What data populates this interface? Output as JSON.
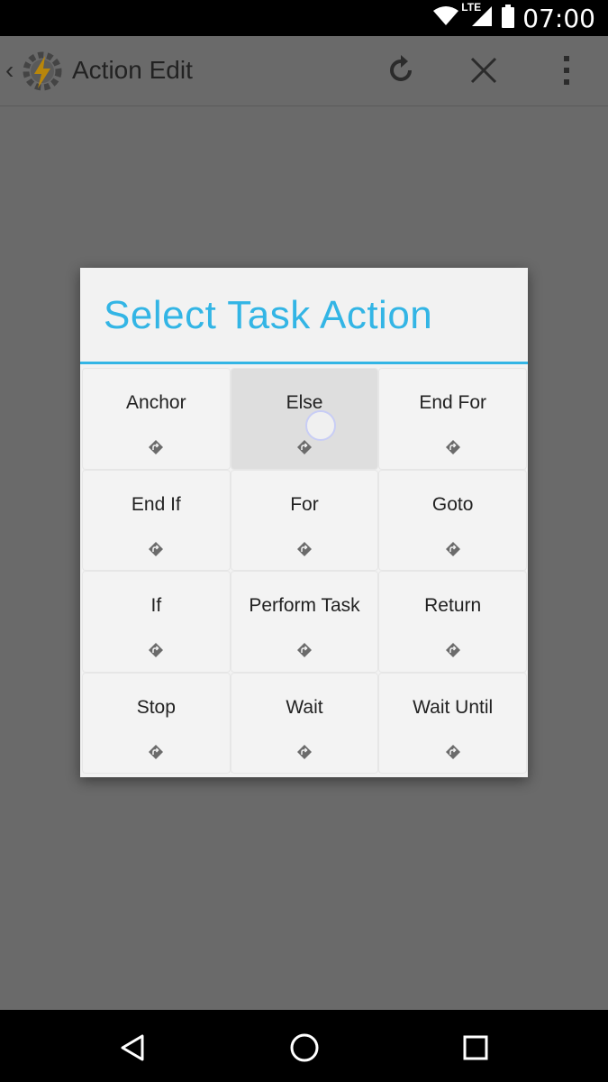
{
  "status_bar": {
    "time": "07:00",
    "network_label": "LTE",
    "icons": [
      "wifi-icon",
      "cell-signal-icon",
      "battery-icon"
    ]
  },
  "app_bar": {
    "title": "Action Edit",
    "icons": [
      "back-chevron-icon",
      "app-logo-icon",
      "undo-icon",
      "close-icon",
      "overflow-menu-icon"
    ]
  },
  "dialog": {
    "title": "Select Task Action",
    "accent_color": "#33b5e5",
    "items": [
      {
        "label": "Anchor"
      },
      {
        "label": "Else",
        "pressed": true
      },
      {
        "label": "End For"
      },
      {
        "label": "End If"
      },
      {
        "label": "For"
      },
      {
        "label": "Goto"
      },
      {
        "label": "If"
      },
      {
        "label": "Perform Task"
      },
      {
        "label": "Return"
      },
      {
        "label": "Stop"
      },
      {
        "label": "Wait"
      },
      {
        "label": "Wait Until"
      }
    ],
    "item_icon": "action-arrow-icon"
  },
  "nav_bar": {
    "icons": [
      "back-icon",
      "home-icon",
      "recents-icon"
    ]
  }
}
